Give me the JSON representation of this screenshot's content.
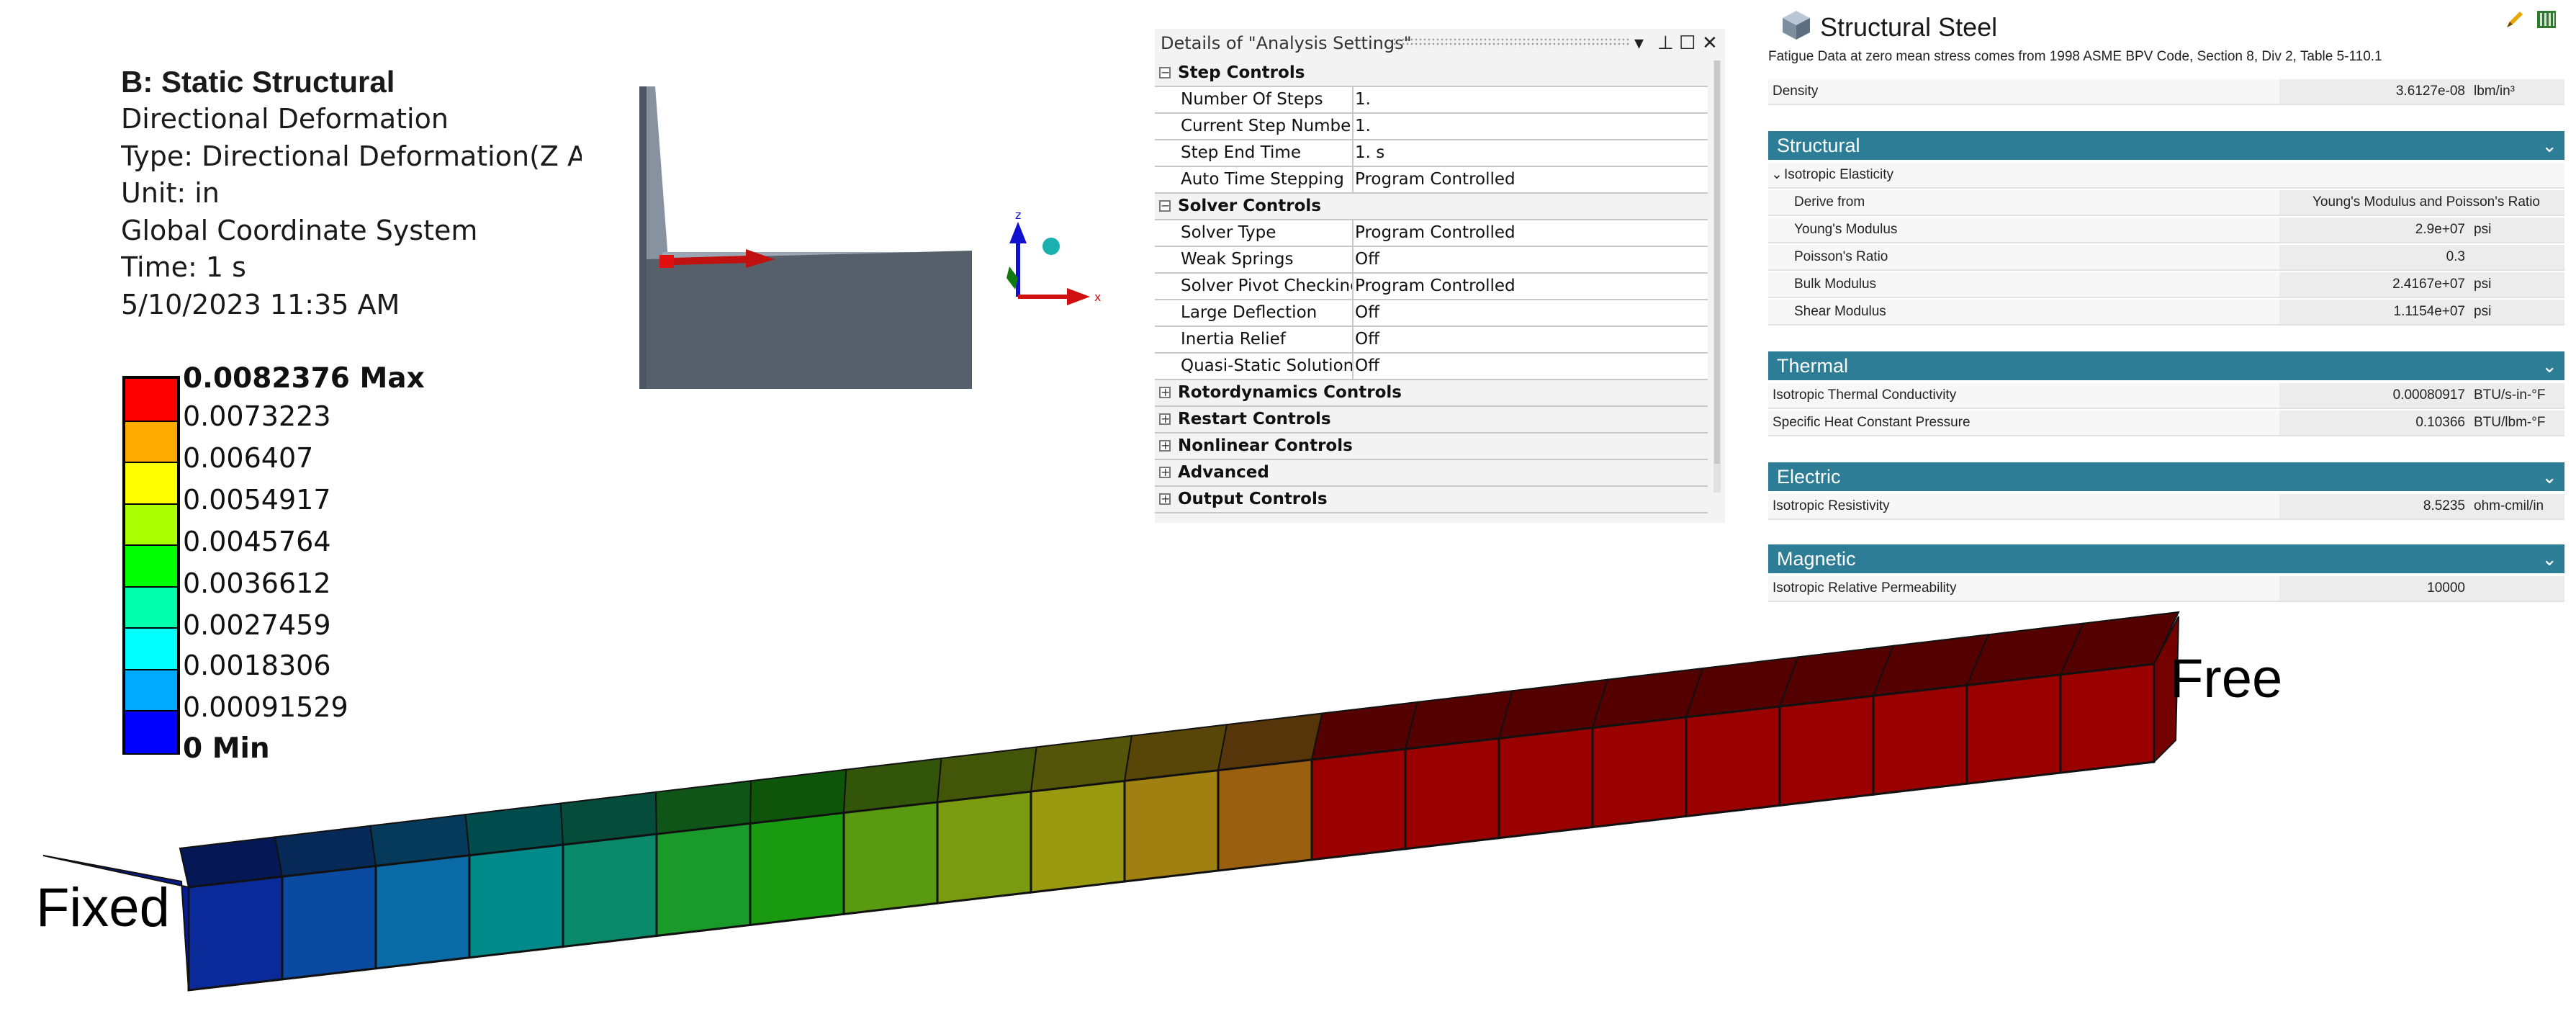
{
  "result_info": {
    "title": "B: Static Structural",
    "lines": [
      "Directional Deformation",
      "Type: Directional Deformation(Z Ax",
      "Unit: in",
      "Global Coordinate System",
      "Time: 1 s",
      "5/10/2023 11:35 AM"
    ]
  },
  "legend": {
    "max_label": "0.0082376 Max",
    "min_label": "0 Min",
    "levels": [
      "0.0073223",
      "0.006407",
      "0.0054917",
      "0.0045764",
      "0.0036612",
      "0.0027459",
      "0.0018306",
      "0.00091529"
    ],
    "colors": [
      "#ff0000",
      "#ffaa00",
      "#ffff00",
      "#aaff00",
      "#00ff00",
      "#00ffaa",
      "#00ffff",
      "#00aaff",
      "#0000ff"
    ]
  },
  "triad": {
    "z_label": "z",
    "x_label": "x"
  },
  "details_panel": {
    "title": "Details of \"Analysis Settings\"",
    "controls": {
      "dropdown": "▾",
      "pin": "⊥",
      "restore": "☐",
      "close": "✕"
    },
    "groups": [
      {
        "name": "Step Controls",
        "expanded": true,
        "expander": "−",
        "rows": [
          {
            "name": "Number Of Steps",
            "value": "1."
          },
          {
            "name": "Current Step Number",
            "value": "1."
          },
          {
            "name": "Step End Time",
            "value": "1. s"
          },
          {
            "name": "Auto Time Stepping",
            "value": "Program Controlled"
          }
        ]
      },
      {
        "name": "Solver Controls",
        "expanded": true,
        "expander": "−",
        "rows": [
          {
            "name": "Solver Type",
            "value": "Program Controlled"
          },
          {
            "name": "Weak Springs",
            "value": "Off"
          },
          {
            "name": "Solver Pivot Checking",
            "value": "Program Controlled"
          },
          {
            "name": "Large Deflection",
            "value": "Off"
          },
          {
            "name": "Inertia Relief",
            "value": "Off"
          },
          {
            "name": "Quasi-Static Solution",
            "value": "Off"
          }
        ]
      },
      {
        "name": "Rotordynamics Controls",
        "expanded": false,
        "expander": "+",
        "rows": []
      },
      {
        "name": "Restart Controls",
        "expanded": false,
        "expander": "+",
        "rows": []
      },
      {
        "name": "Nonlinear Controls",
        "expanded": false,
        "expander": "+",
        "rows": []
      },
      {
        "name": "Advanced",
        "expanded": false,
        "expander": "+",
        "rows": []
      },
      {
        "name": "Output Controls",
        "expanded": false,
        "expander": "+",
        "rows": []
      }
    ]
  },
  "material": {
    "name": "Structural Steel",
    "note": "Fatigue Data at zero mean stress comes from 1998 ASME BPV Code, Section 8, Div 2, Table 5-110.1",
    "density": {
      "name": "Density",
      "value": "3.6127e-08",
      "unit": "lbm/in³"
    },
    "sections": {
      "structural": {
        "title": "Structural",
        "chevron": "⌄",
        "group_name": "Isotropic Elasticity",
        "group_chevron": "⌄",
        "rows": [
          {
            "name": "Derive from",
            "value": "Young's Modulus and Poisson's Ratio",
            "unit": ""
          },
          {
            "name": "Young's Modulus",
            "value": "2.9e+07",
            "unit": "psi"
          },
          {
            "name": "Poisson's Ratio",
            "value": "0.3",
            "unit": ""
          },
          {
            "name": "Bulk Modulus",
            "value": "2.4167e+07",
            "unit": "psi"
          },
          {
            "name": "Shear Modulus",
            "value": "1.1154e+07",
            "unit": "psi"
          }
        ]
      },
      "thermal": {
        "title": "Thermal",
        "chevron": "⌄",
        "rows": [
          {
            "name": "Isotropic Thermal Conductivity",
            "value": "0.00080917",
            "unit": "BTU/s-in-°F"
          },
          {
            "name": "Specific Heat Constant Pressure",
            "value": "0.10366",
            "unit": "BTU/lbm-°F"
          }
        ]
      },
      "electric": {
        "title": "Electric",
        "chevron": "⌄",
        "rows": [
          {
            "name": "Isotropic Resistivity",
            "value": "8.5235",
            "unit": "ohm-cmil/in"
          }
        ]
      },
      "magnetic": {
        "title": "Magnetic",
        "chevron": "⌄",
        "rows": [
          {
            "name": "Isotropic Relative Permeability",
            "value": "10000",
            "unit": ""
          }
        ]
      }
    },
    "icons": [
      "material-cube-icon",
      "edit-pencil-icon",
      "library-icon"
    ]
  },
  "beam_labels": {
    "fixed": "Fixed",
    "free": "Free"
  },
  "beam_colors": {
    "fixed_end": "#061c8e",
    "mid": "#3f8a12",
    "free_end": "#8a0000",
    "segments": [
      "#0a2a9a",
      "#0a4aa0",
      "#0a6aa6",
      "#008a8a",
      "#0a8a6a",
      "#1a9a2a",
      "#1a9a10",
      "#5a9a10",
      "#7a9a10",
      "#9a9a10",
      "#a08010",
      "#9a6010",
      "#9a0000",
      "#9a0000",
      "#9a0000",
      "#9a0000",
      "#9a0000",
      "#9a0000",
      "#9a0000",
      "#9a0000",
      "#9a0000"
    ]
  }
}
